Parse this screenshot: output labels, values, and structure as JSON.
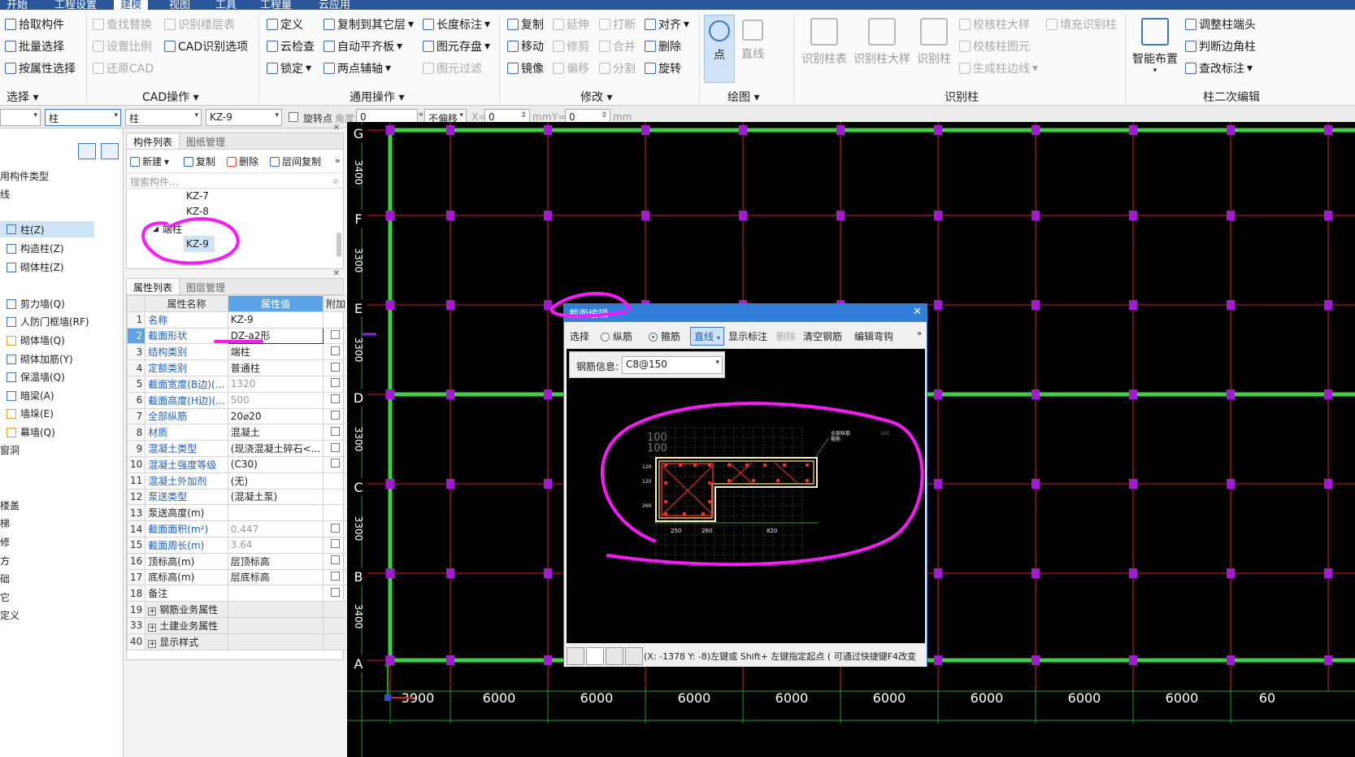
{
  "menu": {
    "tabs": [
      "开始",
      "工程设置",
      "建模",
      "视图",
      "工具",
      "工程量",
      "云应用"
    ],
    "active": "建模"
  },
  "ribbon": {
    "select": {
      "items": [
        "拾取构件",
        "批量选择",
        "按属性选择"
      ],
      "group": "选择"
    },
    "cad": {
      "items": [
        "查找替换",
        "识别楼层表",
        "设置比例",
        "CAD识别选项",
        "还原CAD"
      ],
      "group": "CAD操作"
    },
    "general": {
      "items": [
        "定义",
        "复制到其它层",
        "长度标注",
        "云检查",
        "自动平齐板",
        "图元存盘",
        "锁定",
        "两点辅轴",
        "图元过滤"
      ],
      "group": "通用操作"
    },
    "modify": {
      "items": [
        "复制",
        "延伸",
        "打断",
        "对齐",
        "移动",
        "修剪",
        "合并",
        "删除",
        "镜像",
        "偏移",
        "分割",
        "旋转"
      ],
      "group": "修改"
    },
    "draw": {
      "items": [
        "点",
        "直线"
      ],
      "group": "绘图"
    },
    "identify": {
      "items": [
        "识别柱表",
        "识别柱大样",
        "识别柱",
        "校核柱大样",
        "填充识别柱",
        "校核柱图元",
        "生成柱边线"
      ],
      "group": "识别柱"
    },
    "secondary": {
      "items": [
        "智能布置",
        "调整柱端头",
        "判断边角柱",
        "查改标注"
      ],
      "group": "柱二次编辑"
    }
  },
  "propbar": {
    "floor": "",
    "type1": "柱",
    "type2": "柱",
    "element": "KZ-9",
    "rotate_label": "旋转点",
    "angle_label": "角度:",
    "angle_value": "0",
    "offset": "不偏移",
    "x_label": "X=",
    "x_value": "0",
    "y_label": "Y=",
    "y_value": "0",
    "unit": "mm"
  },
  "left_tree": {
    "items": [
      "用构件类型",
      "线",
      "柱(Z)",
      "构造柱(Z)",
      "砌体柱(Z)",
      "剪力墙(Q)",
      "人防门框墙(RF)",
      "砌体墙(Q)",
      "砌体加筋(Y)",
      "保温墙(Q)",
      "暗梁(A)",
      "墙垛(E)",
      "幕墙(Q)",
      "窗洞",
      "楼盖",
      "梯",
      "修",
      "方",
      "础",
      "它",
      "定义"
    ],
    "selected": "柱(Z)"
  },
  "component_panel": {
    "tabs": [
      "构件列表",
      "图纸管理"
    ],
    "tools": [
      "新建",
      "复制",
      "删除",
      "层间复制"
    ],
    "search_placeholder": "搜索构件...",
    "items": [
      "KZ-7",
      "KZ-8",
      "端柱",
      "KZ-9"
    ],
    "selected": "KZ-9"
  },
  "attr_panel": {
    "tabs": [
      "属性列表",
      "图层管理"
    ],
    "headers": [
      "属性名称",
      "属性值",
      "附加"
    ],
    "rows": [
      {
        "n": "1",
        "name": "名称",
        "value": "KZ-9",
        "blue": true,
        "gray": false,
        "cb": false
      },
      {
        "n": "2",
        "name": "截面形状",
        "value": "DZ-a2形",
        "blue": true,
        "gray": false,
        "cb": true
      },
      {
        "n": "3",
        "name": "结构类别",
        "value": "端柱",
        "blue": true,
        "gray": false,
        "cb": true
      },
      {
        "n": "4",
        "name": "定额类别",
        "value": "普通柱",
        "blue": true,
        "gray": false,
        "cb": true
      },
      {
        "n": "5",
        "name": "截面宽度(B边)(...",
        "value": "1320",
        "blue": true,
        "gray": true,
        "cb": true
      },
      {
        "n": "6",
        "name": "截面高度(H边)(...",
        "value": "500",
        "blue": true,
        "gray": true,
        "cb": true
      },
      {
        "n": "7",
        "name": "全部纵筋",
        "value": "20⌀20",
        "blue": true,
        "gray": false,
        "cb": true
      },
      {
        "n": "8",
        "name": "材质",
        "value": "混凝土",
        "blue": true,
        "gray": false,
        "cb": true
      },
      {
        "n": "9",
        "name": "混凝土类型",
        "value": "(现浇混凝土碎石<...",
        "blue": true,
        "gray": false,
        "cb": true
      },
      {
        "n": "10",
        "name": "混凝土强度等级",
        "value": "(C30)",
        "blue": true,
        "gray": false,
        "cb": true
      },
      {
        "n": "11",
        "name": "混凝土外加剂",
        "value": "(无)",
        "blue": true,
        "gray": false,
        "cb": false
      },
      {
        "n": "12",
        "name": "泵送类型",
        "value": "(混凝土泵)",
        "blue": true,
        "gray": false,
        "cb": false
      },
      {
        "n": "13",
        "name": "泵送高度(m)",
        "value": "",
        "blue": false,
        "gray": false,
        "cb": false
      },
      {
        "n": "14",
        "name": "截面面积(m²)",
        "value": "0.447",
        "blue": true,
        "gray": true,
        "cb": true
      },
      {
        "n": "15",
        "name": "截面周长(m)",
        "value": "3.64",
        "blue": true,
        "gray": true,
        "cb": true
      },
      {
        "n": "16",
        "name": "顶标高(m)",
        "value": "层顶标高",
        "blue": false,
        "gray": false,
        "cb": true
      },
      {
        "n": "17",
        "name": "底标高(m)",
        "value": "层底标高",
        "blue": false,
        "gray": false,
        "cb": true
      },
      {
        "n": "18",
        "name": "备注",
        "value": "",
        "blue": false,
        "gray": false,
        "cb": true
      },
      {
        "n": "19",
        "name": "钢筋业务属性",
        "value": "",
        "blue": false,
        "gray": false,
        "cb": false,
        "group": true
      },
      {
        "n": "33",
        "name": "土建业务属性",
        "value": "",
        "blue": false,
        "gray": false,
        "cb": false,
        "group": true
      },
      {
        "n": "40",
        "name": "显示样式",
        "value": "",
        "blue": false,
        "gray": false,
        "cb": false,
        "group": true
      }
    ]
  },
  "canvas": {
    "axis_labels": [
      "G",
      "F",
      "E",
      "D",
      "C",
      "B",
      "A"
    ],
    "dim_labels": [
      "3900",
      "6000",
      "6000",
      "6000",
      "6000",
      "6000",
      "6000",
      "6000",
      "6000",
      "60"
    ],
    "left_dims": [
      "3400",
      "3300",
      "3300",
      "3300",
      "3300",
      "3400"
    ]
  },
  "dialog": {
    "title": "截面编辑",
    "tools": {
      "select": "选择",
      "longitudinal": "纵筋",
      "stirrup": "箍筋",
      "line": "直线",
      "show_marks": "显示标注",
      "delete": "删除",
      "clear_rebar": "清空钢筋",
      "edit_hook": "编辑弯钩"
    },
    "rebar_info_label": "钢筋信息:",
    "rebar_info_value": "C8@150",
    "status_text": "(X: -1378 Y: -8)左键或 Shift+ 左键指定起点 ( 可通过快捷键F4改变",
    "section_dims": [
      "250",
      "260",
      "820"
    ],
    "section_side": [
      "120",
      "120",
      "260"
    ],
    "section_top": [
      "100",
      "100"
    ],
    "section_notes": [
      "全部纵筋",
      "箍筋"
    ]
  },
  "colors": {
    "accent": "#2b579a",
    "grid_green": "#3fd13f",
    "grid_red": "#e01d1d",
    "column": "#a21ad4",
    "annotation": "#ff16ff"
  }
}
